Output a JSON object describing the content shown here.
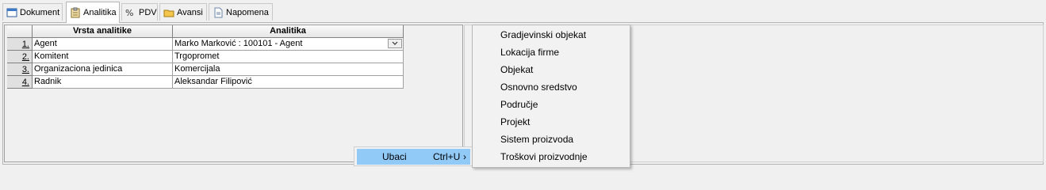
{
  "tabs": [
    {
      "label": "Dokument",
      "icon": "window-icon",
      "active": false
    },
    {
      "label": "Analitika",
      "icon": "clipboard-icon",
      "active": true
    },
    {
      "label": "PDV",
      "icon": "percent-icon",
      "active": false
    },
    {
      "label": "Avansi",
      "icon": "folder-icon",
      "active": false
    },
    {
      "label": "Napomena",
      "icon": "note-icon",
      "active": false
    }
  ],
  "grid": {
    "headers": [
      "Vrsta analitike",
      "Analitika"
    ],
    "rows": [
      {
        "num": "1.",
        "type": "Agent",
        "value": "Marko Marković : 100101 - Agent"
      },
      {
        "num": "2.",
        "type": "Komitent",
        "value": "Trgopromet"
      },
      {
        "num": "3.",
        "type": "Organizaciona jedinica",
        "value": "Komercijala"
      },
      {
        "num": "4.",
        "type": "Radnik",
        "value": "Aleksandar Filipović"
      }
    ]
  },
  "context_menu": {
    "item_label": "Ubaci",
    "shortcut": "Ctrl+U",
    "arrow": "›"
  },
  "submenu": {
    "items": [
      "Gradjevinski objekat",
      "Lokacija firme",
      "Objekat",
      "Osnovno sredstvo",
      "Područje",
      "Projekt",
      "Sistem proizvoda",
      "Troškovi proizvodnje"
    ]
  },
  "colors": {
    "highlight": "#91c9f7",
    "background": "#f0f0f0"
  }
}
